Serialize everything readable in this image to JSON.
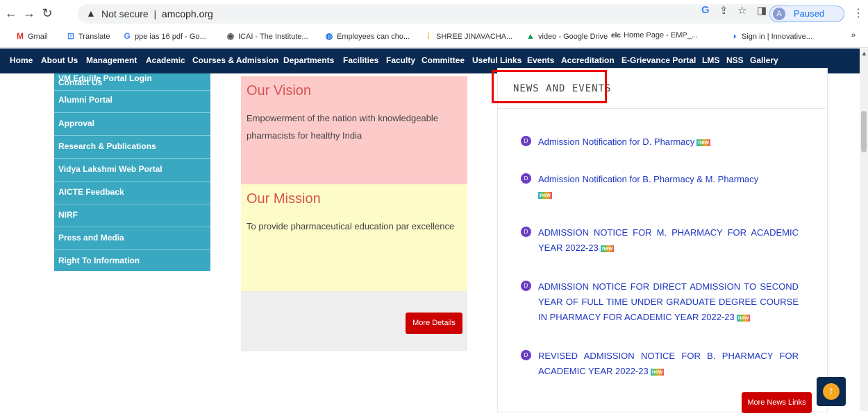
{
  "browser": {
    "security_label": "Not secure",
    "url": "amcoph.org",
    "profile_initial": "A",
    "profile_status": "Paused"
  },
  "bookmarks": [
    {
      "label": "Gmail",
      "icon": "gmail-icon",
      "glyph": "M"
    },
    {
      "label": "Translate",
      "icon": "translate-icon",
      "glyph": "⊡"
    },
    {
      "label": "ppe ias 16 pdf - Go...",
      "icon": "google-icon",
      "glyph": "G"
    },
    {
      "label": "ICAI - The Institute...",
      "icon": "icai-icon",
      "glyph": "◉"
    },
    {
      "label": "Employees can cho...",
      "icon": "people-icon",
      "glyph": "◍"
    },
    {
      "label": "SHREE JINAVACHA...",
      "icon": "doc-icon",
      "glyph": "⁞"
    },
    {
      "label": "video - Google Drive",
      "icon": "drive-icon",
      "glyph": "▲"
    },
    {
      "label": "Home Page - EMP_...",
      "icon": "elc-icon",
      "glyph": "elc"
    },
    {
      "label": "Sign in | Innovative...",
      "icon": "signin-icon",
      "glyph": "◑"
    }
  ],
  "bookmarks_overflow": "»",
  "site_nav": [
    "Home",
    "About Us",
    "Management",
    "Academic",
    "Courses & Admission",
    "Departments",
    "Facilities",
    "Faculty",
    "Committee",
    "Useful Links",
    "Events",
    "Accreditation",
    "E-Grievance Portal",
    "LMS",
    "NSS",
    "Gallery"
  ],
  "sidebar": {
    "items": [
      "Contact Us",
      "Alumni Portal",
      "Approval",
      "Research & Publications",
      "Vidya Lakshmi Web Portal",
      "AICTE Feedback",
      "NIRF",
      "Press and Media",
      "Right To Information"
    ],
    "overlay_item": "VM Edulife Portal Login"
  },
  "vision": {
    "title": "Our Vision",
    "text": "Empowerment of the nation with knowledgeable pharmacists for healthy India"
  },
  "mission": {
    "title": "Our Mission",
    "text": "To provide pharmaceutical education par excellence"
  },
  "more_details_label": "More Details",
  "news": {
    "title": "NEWS AND EVENTS",
    "badge": "new",
    "items": [
      "Admission Notification for D. Pharmacy",
      "Admission Notification for B. Pharmacy & M. Pharmacy",
      "ADMISSION NOTICE FOR M. PHARMACY FOR ACADEMIC YEAR 2022-23",
      "ADMISSION NOTICE FOR DIRECT ADMISSION TO SECOND YEAR OF FULL TIME UNDER GRADUATE DEGREE COURSE IN PHARMACY FOR ACADEMIC YEAR 2022-23",
      "REVISED ADMISSION NOTICE FOR B. PHARMACY FOR ACADEMIC YEAR 2022-23"
    ],
    "more_label": "More News Links"
  },
  "colors": {
    "nav_bg": "#0b2a52",
    "sidebar_bg": "#3aa8c1",
    "vision_bg": "#fdcaca",
    "mission_bg": "#fdfcc8",
    "accent_red": "#cc0000",
    "news_link": "#1f37c2",
    "highlight": "#ee0000"
  }
}
